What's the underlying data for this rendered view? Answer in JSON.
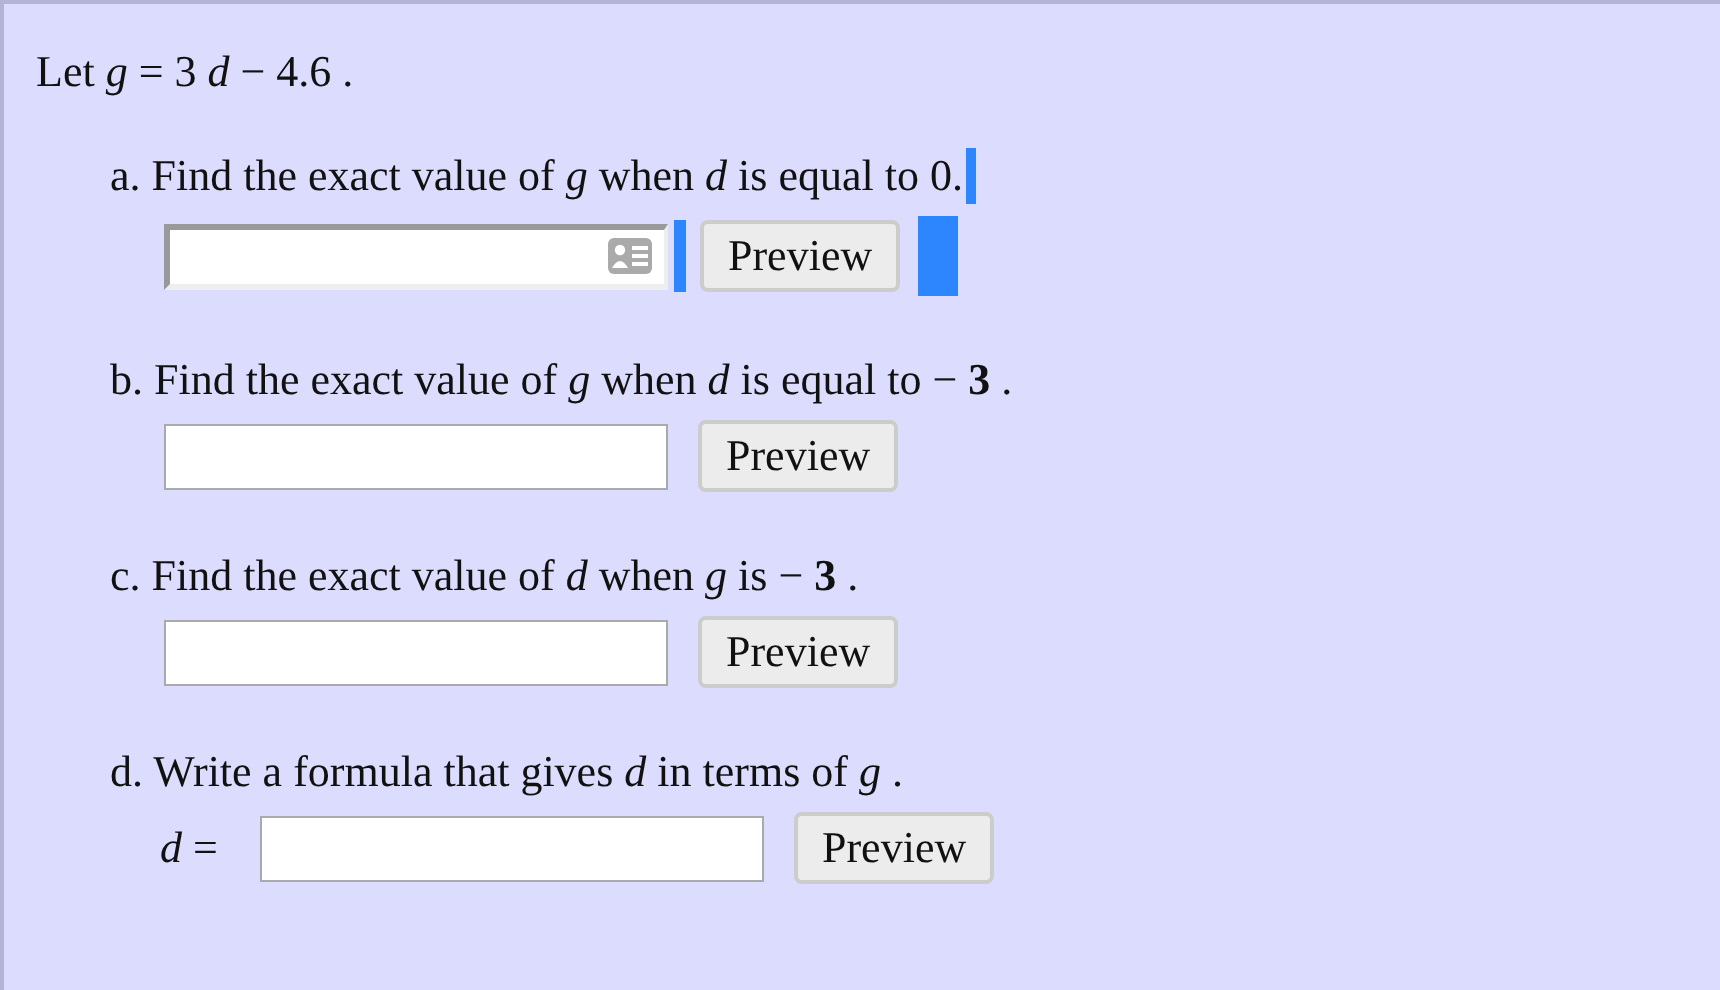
{
  "intro": "Let *g* = 3 *d* − 4.6 .",
  "parts": [
    {
      "text": "a. Find the exact value of *g* when *d* is equal to 0.",
      "focused": true,
      "button": "Preview"
    },
    {
      "text": "b. Find the exact value of *g* when *d* is equal to − **3** .",
      "focused": false,
      "button": "Preview"
    },
    {
      "text": "c. Find the exact value of *d* when *g* is − **3** .",
      "focused": false,
      "button": "Preview"
    },
    {
      "text": "d. Write a formula that gives *d* in terms of *g* .",
      "prefix": "*d* =",
      "focused": false,
      "button": "Preview"
    }
  ]
}
